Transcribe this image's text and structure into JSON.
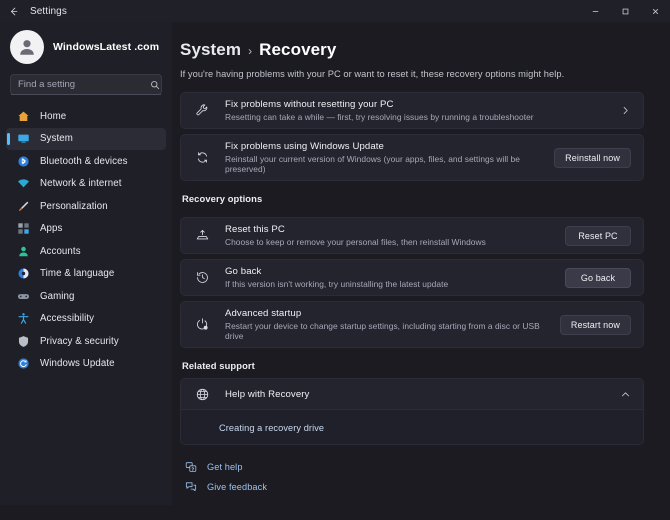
{
  "window": {
    "title": "Settings",
    "back_icon": "arrow-left-icon",
    "controls": [
      {
        "name": "minimize-button",
        "glyph": "minimize-icon"
      },
      {
        "name": "maximize-button",
        "glyph": "maximize-icon"
      },
      {
        "name": "close-button",
        "glyph": "close-icon"
      }
    ]
  },
  "sidebar": {
    "account": {
      "name": "WindowsLatest .com",
      "avatar_icon": "user-avatar-icon"
    },
    "search": {
      "placeholder": "Find a setting",
      "value": "",
      "icon": "search-icon"
    },
    "items": [
      {
        "label": "Home",
        "icon": "home-icon",
        "selected": false
      },
      {
        "label": "System",
        "icon": "system-monitor-icon",
        "selected": true
      },
      {
        "label": "Bluetooth & devices",
        "icon": "bluetooth-icon",
        "selected": false
      },
      {
        "label": "Network & internet",
        "icon": "wifi-icon",
        "selected": false
      },
      {
        "label": "Personalization",
        "icon": "paintbrush-icon",
        "selected": false
      },
      {
        "label": "Apps",
        "icon": "apps-grid-icon",
        "selected": false
      },
      {
        "label": "Accounts",
        "icon": "person-icon",
        "selected": false
      },
      {
        "label": "Time & language",
        "icon": "clock-globe-icon",
        "selected": false
      },
      {
        "label": "Gaming",
        "icon": "gamepad-icon",
        "selected": false
      },
      {
        "label": "Accessibility",
        "icon": "accessibility-icon",
        "selected": false
      },
      {
        "label": "Privacy & security",
        "icon": "shield-icon",
        "selected": false
      },
      {
        "label": "Windows Update",
        "icon": "update-refresh-icon",
        "selected": false
      }
    ]
  },
  "main": {
    "breadcrumb": {
      "parent": "System",
      "separator": "›",
      "current": "Recovery"
    },
    "subtitle": "If you're having problems with your PC or want to reset it, these recovery options might help.",
    "top_cards": [
      {
        "title": "Fix problems without resetting your PC",
        "desc": "Resetting can take a while — first, try resolving issues by running a troubleshooter",
        "icon": "wrench-icon",
        "action_type": "chevron",
        "action_label": "›"
      },
      {
        "title": "Fix problems using Windows Update",
        "desc": "Reinstall your current version of Windows (your apps, files, and settings will be preserved)",
        "icon": "refresh-icon",
        "action_type": "button",
        "action_label": "Reinstall now"
      }
    ],
    "recovery_options_heading": "Recovery options",
    "recovery_cards": [
      {
        "title": "Reset this PC",
        "desc": "Choose to keep or remove your personal files, then reinstall Windows",
        "icon": "reset-pc-icon",
        "action_label": "Reset PC",
        "hovered": false
      },
      {
        "title": "Go back",
        "desc": "If this version isn't working, try uninstalling the latest update",
        "icon": "history-clock-icon",
        "action_label": "Go back",
        "hovered": true
      },
      {
        "title": "Advanced startup",
        "desc": "Restart your device to change startup settings, including starting from a disc or USB drive",
        "icon": "power-gear-icon",
        "action_label": "Restart now",
        "hovered": false
      }
    ],
    "related_support_heading": "Related support",
    "expander": {
      "title": "Help with Recovery",
      "icon": "globe-help-icon",
      "chevron": "chevron-up-icon",
      "expanded": true,
      "links": [
        "Creating a recovery drive"
      ]
    },
    "footer_links": [
      {
        "label": "Get help",
        "icon": "get-help-icon"
      },
      {
        "label": "Give feedback",
        "icon": "give-feedback-icon"
      }
    ]
  },
  "colors": {
    "accent": "#4cc2ff",
    "window_bg": "#1f1f27",
    "content_bg": "#1b1b21",
    "card_bg": "#24242e",
    "link": "#9dc2ee"
  }
}
